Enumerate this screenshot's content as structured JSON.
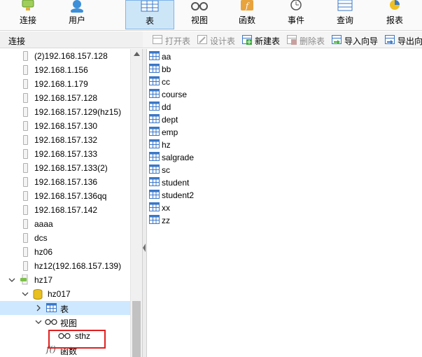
{
  "toolbar": {
    "connect_label": "连接",
    "user_label": "用户",
    "table_label": "表",
    "view_label": "视图",
    "function_label": "函数",
    "event_label": "事件",
    "query_label": "查询",
    "report_label": "报表"
  },
  "left_panel": {
    "header": "连接"
  },
  "object_toolbar": {
    "open_table": "打开表",
    "design_table": "设计表",
    "new_table": "新建表",
    "delete_table": "删除表",
    "import_wizard": "导入向导",
    "export_wizard": "导出向"
  },
  "tree": {
    "connections": [
      "(2)192.168.157.128",
      "192.168.1.156",
      "192.168.1.179",
      "192.168.157.128",
      "192.168.157.129(hz15)",
      "192.168.157.130",
      "192.168.157.132",
      "192.168.157.133",
      "192.168.157.133(2)",
      "192.168.157.136",
      "192.168.157.136qq",
      "192.168.157.142",
      "aaaa",
      "dcs",
      "hz06",
      "hz12(192.168.157.139)"
    ],
    "open_connection": "hz17",
    "database": "hz017",
    "tables_node": "表",
    "views_node": "视图",
    "view_item": "sthz",
    "functions_node": "函数"
  },
  "tables": [
    "aa",
    "bb",
    "cc",
    "course",
    "dd",
    "dept",
    "emp",
    "hz",
    "salgrade",
    "sc",
    "student",
    "student2",
    "xx",
    "zz"
  ],
  "colors": {
    "selected_row": "#cde8ff",
    "active_toolbar": "#cde6f7",
    "highlight_box": "#e02020"
  }
}
